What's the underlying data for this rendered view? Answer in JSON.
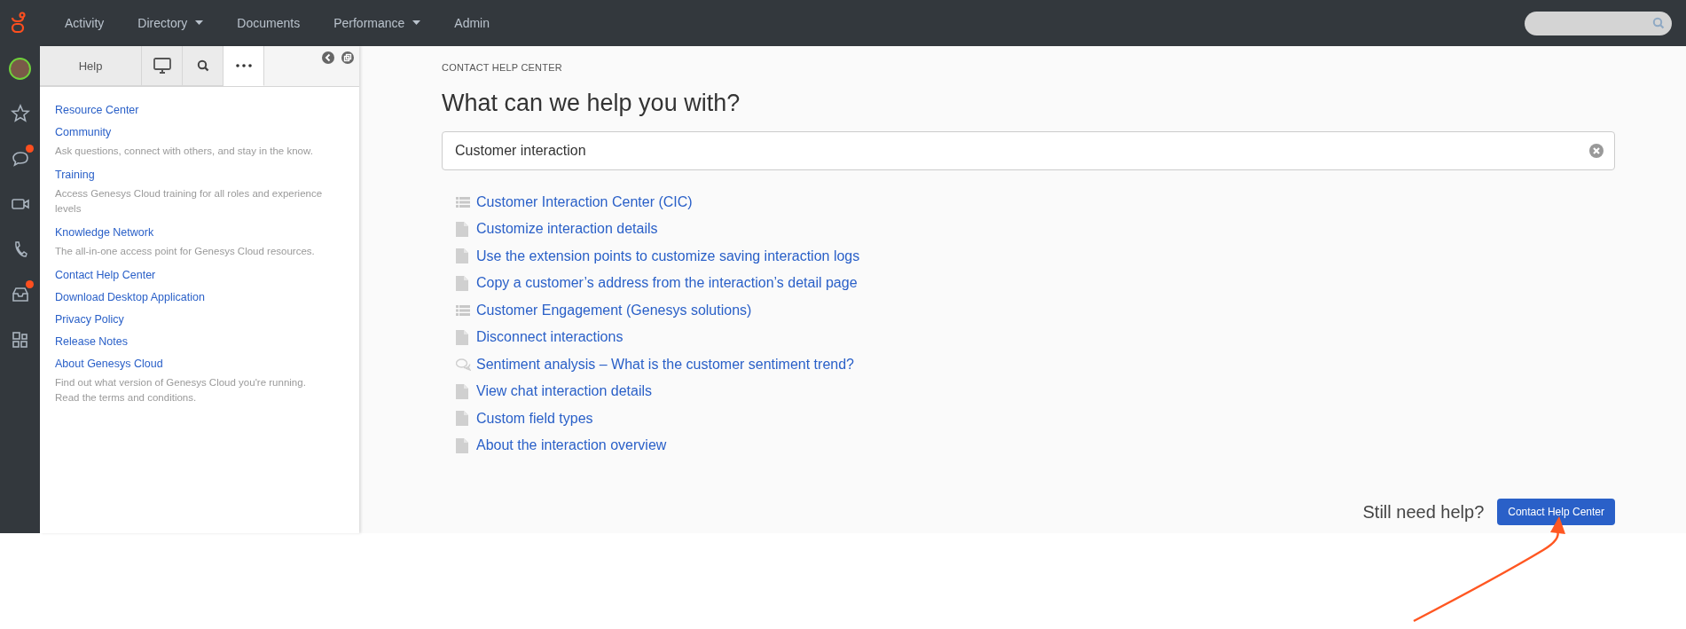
{
  "top_nav": {
    "items": [
      {
        "label": "Activity",
        "has_menu": false
      },
      {
        "label": "Directory",
        "has_menu": true
      },
      {
        "label": "Documents",
        "has_menu": false
      },
      {
        "label": "Performance",
        "has_menu": true
      },
      {
        "label": "Admin",
        "has_menu": false
      }
    ]
  },
  "rail": {
    "items": [
      {
        "kind": "avatar",
        "badge": false
      },
      {
        "kind": "star",
        "badge": false
      },
      {
        "kind": "chat",
        "badge": true
      },
      {
        "kind": "video",
        "badge": false
      },
      {
        "kind": "phone",
        "badge": false
      },
      {
        "kind": "inbox",
        "badge": true
      },
      {
        "kind": "apps",
        "badge": false
      }
    ]
  },
  "help_panel": {
    "tabs": [
      {
        "kind": "text",
        "label": "Help",
        "selected": false
      },
      {
        "kind": "monitor",
        "selected": false
      },
      {
        "kind": "search",
        "selected": false
      },
      {
        "kind": "more",
        "selected": true
      }
    ],
    "links": [
      {
        "title": "Resource Center"
      },
      {
        "title": "Community",
        "description": "Ask questions, connect with others, and stay in the know."
      },
      {
        "title": "Training",
        "description": "Access Genesys Cloud training for all roles and experience levels"
      },
      {
        "title": "Knowledge Network",
        "description": "The all-in-one access point for Genesys Cloud resources."
      },
      {
        "title": "Contact Help Center"
      },
      {
        "title": "Download Desktop Application"
      },
      {
        "title": "Privacy Policy"
      },
      {
        "title": "Release Notes"
      },
      {
        "title": "About Genesys Cloud",
        "description": "Find out what version of Genesys Cloud you're running. Read the terms and conditions."
      }
    ]
  },
  "main": {
    "eyebrow": "CONTACT HELP CENTER",
    "heading": "What can we help you with?",
    "search": {
      "value": "Customer interaction"
    },
    "results": [
      {
        "kind": "category",
        "title": "Customer Interaction Center (CIC)"
      },
      {
        "kind": "article",
        "title": "Customize interaction details"
      },
      {
        "kind": "article",
        "title": "Use the extension points to customize saving interaction logs"
      },
      {
        "kind": "article",
        "title": "Copy a customer’s address from the interaction’s detail page"
      },
      {
        "kind": "category",
        "title": "Customer Engagement (Genesys solutions)"
      },
      {
        "kind": "article",
        "title": "Disconnect interactions"
      },
      {
        "kind": "discussion",
        "title": "Sentiment analysis – What is the customer sentiment trend?"
      },
      {
        "kind": "article",
        "title": "View chat interaction details"
      },
      {
        "kind": "article",
        "title": "Custom field types"
      },
      {
        "kind": "article",
        "title": "About the interaction overview"
      }
    ],
    "footer": {
      "prompt": "Still need help?",
      "button": "Contact Help Center"
    }
  }
}
